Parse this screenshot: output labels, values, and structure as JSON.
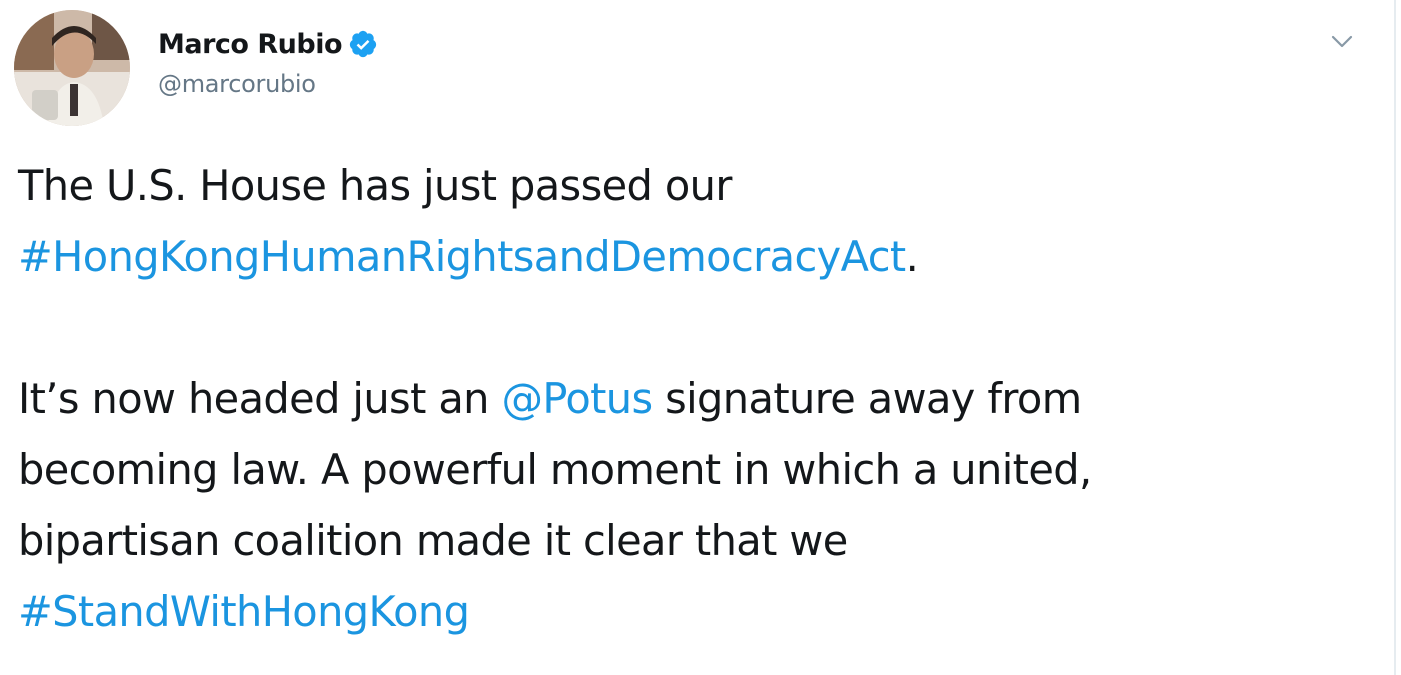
{
  "tweet": {
    "author": {
      "display_name": "Marco Rubio",
      "handle": "@marcorubio",
      "verified": true,
      "avatar_icon": "profile-photo"
    },
    "menu_icon": "chevron-down-icon",
    "colors": {
      "text": "#14171a",
      "secondary": "#657786",
      "link": "#1b95e0",
      "verified": "#1da1f2"
    },
    "body": {
      "p1_text": "The U.S. House has just passed our",
      "p1_hashtag": "#HongKongHumanRightsandDemocracyAct",
      "p1_end": ".",
      "p2_before_mention": "It’s now headed just an",
      "p2_mention": "@Potus",
      "p2_after_mention": "signature away from",
      "p2_line2": "becoming law. A powerful moment in which a united,",
      "p2_line3": "bipartisan coalition made it clear that we",
      "p2_hashtag": "#StandWithHongKong"
    }
  }
}
